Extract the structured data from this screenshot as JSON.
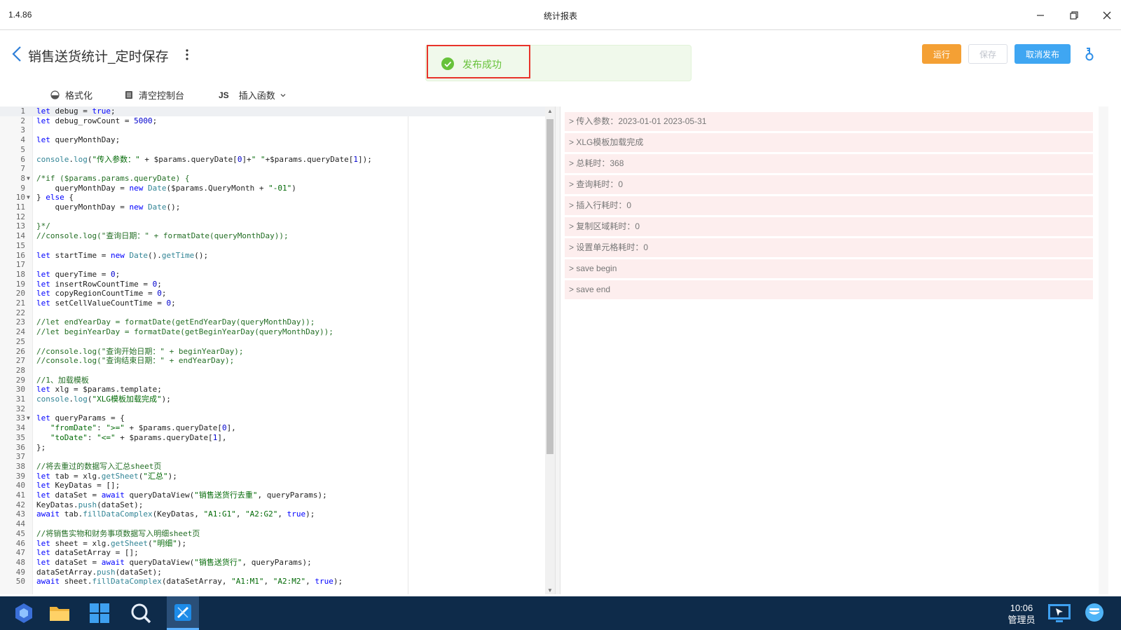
{
  "window": {
    "version": "1.4.86",
    "title": "统计报表"
  },
  "header": {
    "doc_title": "销售送货统计_定时保存",
    "toast_message": "发布成功",
    "run_label": "运行",
    "save_label": "保存",
    "cancel_publish_label": "取消发布"
  },
  "toolbar": {
    "format_label": "格式化",
    "clear_console_label": "清空控制台",
    "js_badge": "JS",
    "insert_function_label": "插入函数"
  },
  "editor": {
    "lines": [
      "let debug = true;",
      "let debug_rowCount = 5000;",
      "",
      "let queryMonthDay;",
      "",
      "console.log(\"传入参数：\" + $params.queryDate[0]+\" \"+$params.queryDate[1]);",
      "",
      "/*if ($params.params.queryDate) {",
      "    queryMonthDay = new Date($params.QueryMonth + \"-01\")",
      "} else {",
      "    queryMonthDay = new Date();",
      "",
      "}*/",
      "//console.log(\"查询日期：\" + formatDate(queryMonthDay));",
      "",
      "let startTime = new Date().getTime();",
      "",
      "let queryTime = 0;",
      "let insertRowCountTime = 0;",
      "let copyRegionCountTime = 0;",
      "let setCellValueCountTime = 0;",
      "",
      "//let endYearDay = formatDate(getEndYearDay(queryMonthDay));",
      "//let beginYearDay = formatDate(getBeginYearDay(queryMonthDay));",
      "",
      "//console.log(\"查询开始日期：\" + beginYearDay);",
      "//console.log(\"查询结束日期：\" + endYearDay);",
      "",
      "//1、加载模板",
      "let xlg = $params.template;",
      "console.log(\"XLG模板加载完成\");",
      "",
      "let queryParams = {",
      "   \"fromDate\": \">=\" + $params.queryDate[0],",
      "   \"toDate\": \"<=\" + $params.queryDate[1],",
      "};",
      "",
      "//将去重过的数据写入汇总sheet页",
      "let tab = xlg.getSheet(\"汇总\");",
      "let KeyDatas = [];",
      "let dataSet2 = await queryDataView(\"销售送货行去重\", queryParams);",
      "KeyDatas.push(dataSet2);",
      "await tab.fillDataComplex(KeyDatas, \"A1:G1\", \"A2:G2\", true);",
      "",
      "//将销售实物和财务事项数据写入明细sheet页",
      "let sheet = xlg.getSheet(\"明细\");",
      "let dataSetArray = [];",
      "let dataSet = await queryDataView(\"销售送货行\", queryParams);",
      "dataSetArray.push(dataSet);",
      "await sheet.fillDataComplex(dataSetArray, \"A1:M1\", \"A2:M2\", true);"
    ],
    "fold_lines": [
      8,
      10,
      33
    ]
  },
  "console": {
    "lines": [
      "> 传入参数：2023-01-01 2023-05-31",
      "> XLG模板加载完成",
      "> 总耗时：368",
      "> 查询耗时：0",
      "> 插入行耗时：0",
      "> 复制区域耗时：0",
      "> 设置单元格耗时：0",
      "> save begin",
      "> save end"
    ]
  },
  "taskbar": {
    "time": "10:06",
    "user": "管理员",
    "icons": [
      "app-launcher-icon",
      "folder-icon",
      "windows-grid-icon",
      "search-icon",
      "report-designer-icon"
    ]
  },
  "colors": {
    "run": "#f4a034",
    "cancel_publish": "#3fa6f2",
    "toast_bg": "#f0f9eb",
    "toast_text": "#67c23a",
    "highlight_box": "#e8332a",
    "taskbar": "#0e2b4a"
  }
}
